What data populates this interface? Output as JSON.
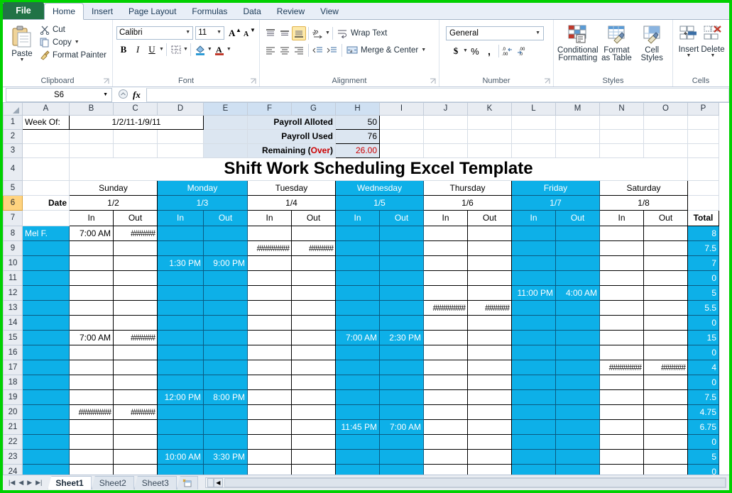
{
  "window": {
    "accent_green": "#00D000",
    "cyan": "#0DB0E8",
    "tint": "#dce6f1"
  },
  "tabs": {
    "file": "File",
    "items": [
      "Home",
      "Insert",
      "Page Layout",
      "Formulas",
      "Data",
      "Review",
      "View"
    ],
    "active": "Home"
  },
  "ribbon": {
    "clipboard": {
      "label": "Clipboard",
      "paste": "Paste",
      "cut": "Cut",
      "copy": "Copy",
      "format_painter": "Format Painter"
    },
    "font": {
      "label": "Font",
      "family": "Calibri",
      "size": "11",
      "bold": "B",
      "italic": "I",
      "underline": "U"
    },
    "alignment": {
      "label": "Alignment",
      "wrap_text": "Wrap Text",
      "merge_center": "Merge & Center"
    },
    "number": {
      "label": "Number",
      "format": "General",
      "currency": "$",
      "percent": "%",
      "comma": ","
    },
    "styles": {
      "label": "Styles",
      "conditional_formatting": "Conditional\nFormatting",
      "conditional_line1": "Conditional",
      "conditional_line2": "Formatting",
      "format_as_table_line1": "Format",
      "format_as_table_line2": "as Table",
      "cell_styles_line1": "Cell",
      "cell_styles_line2": "Styles"
    },
    "cells": {
      "label": "Cells",
      "insert": "Insert",
      "delete": "Delete"
    }
  },
  "formula_bar": {
    "name_box": "S6",
    "formula": ""
  },
  "grid": {
    "columns": [
      "A",
      "B",
      "C",
      "D",
      "E",
      "F",
      "G",
      "H",
      "I",
      "J",
      "K",
      "L",
      "M",
      "N",
      "O",
      "P"
    ],
    "selected_columns": [
      "E",
      "F",
      "G",
      "H"
    ],
    "selected_row": "6",
    "rows": [
      "1",
      "2",
      "3",
      "4",
      "5",
      "6",
      "7",
      "8",
      "9",
      "10",
      "11",
      "12",
      "13",
      "14",
      "15",
      "16",
      "17",
      "18",
      "19",
      "20",
      "21",
      "22",
      "23",
      "24"
    ]
  },
  "sheet": {
    "week_of_label": "Week Of:",
    "week_of_value": "1/2/11-1/9/11",
    "payroll": [
      {
        "label": "Payroll Alloted",
        "value": "50",
        "over": false
      },
      {
        "label": "Payroll Used",
        "value": "76",
        "over": false
      },
      {
        "label": "Remaining (",
        "label_red": "Over",
        "label_end": ")",
        "value": "26.00",
        "over": true
      }
    ],
    "title": "Shift Work Scheduling Excel Template",
    "date_label": "Date",
    "total_label": "Total",
    "in_label": "In",
    "out_label": "Out",
    "days": [
      {
        "name": "Sunday",
        "date": "1/2",
        "highlight": false
      },
      {
        "name": "Monday",
        "date": "1/3",
        "highlight": true
      },
      {
        "name": "Tuesday",
        "date": "1/4",
        "highlight": false
      },
      {
        "name": "Wednesday",
        "date": "1/5",
        "highlight": true
      },
      {
        "name": "Thursday",
        "date": "1/6",
        "highlight": false
      },
      {
        "name": "Friday",
        "date": "1/7",
        "highlight": true
      },
      {
        "name": "Saturday",
        "date": "1/8",
        "highlight": false
      }
    ],
    "hash_short": "######",
    "hash_long": "########",
    "entries": [
      {
        "row": "8",
        "name": "Mel F.",
        "cells": [
          "7:00 AM",
          "######",
          "",
          "",
          "",
          "",
          "",
          "",
          "",
          "",
          "",
          "",
          "",
          ""
        ],
        "total": "8"
      },
      {
        "row": "9",
        "name": "",
        "cells": [
          "",
          "",
          "",
          "",
          "########",
          "######",
          "",
          "",
          "",
          "",
          "",
          "",
          "",
          ""
        ],
        "total": "7.5"
      },
      {
        "row": "10",
        "name": "",
        "cells": [
          "",
          "",
          "1:30 PM",
          "9:00 PM",
          "",
          "",
          "",
          "",
          "",
          "",
          "",
          "",
          "",
          ""
        ],
        "total": "7"
      },
      {
        "row": "11",
        "name": "",
        "cells": [
          "",
          "",
          "",
          "",
          "",
          "",
          "",
          "",
          "",
          "",
          "",
          "",
          "",
          ""
        ],
        "total": "0"
      },
      {
        "row": "12",
        "name": "",
        "cells": [
          "",
          "",
          "",
          "",
          "",
          "",
          "",
          "",
          "",
          "",
          "11:00 PM",
          "4:00 AM",
          "",
          ""
        ],
        "total": "5"
      },
      {
        "row": "13",
        "name": "",
        "cells": [
          "",
          "",
          "",
          "",
          "",
          "",
          "",
          "",
          "########",
          "######",
          "",
          "",
          "",
          ""
        ],
        "total": "5.5"
      },
      {
        "row": "14",
        "name": "",
        "cells": [
          "",
          "",
          "",
          "",
          "",
          "",
          "",
          "",
          "",
          "",
          "",
          "",
          "",
          ""
        ],
        "total": "0"
      },
      {
        "row": "15",
        "name": "",
        "cells": [
          "7:00 AM",
          "######",
          "",
          "",
          "",
          "",
          "7:00 AM",
          "2:30 PM",
          "",
          "",
          "",
          "",
          "",
          ""
        ],
        "total": "15"
      },
      {
        "row": "16",
        "name": "",
        "cells": [
          "",
          "",
          "",
          "",
          "",
          "",
          "",
          "",
          "",
          "",
          "",
          "",
          "",
          ""
        ],
        "total": "0"
      },
      {
        "row": "17",
        "name": "",
        "cells": [
          "",
          "",
          "",
          "",
          "",
          "",
          "",
          "",
          "",
          "",
          "",
          "",
          "########",
          "######"
        ],
        "total": "4"
      },
      {
        "row": "18",
        "name": "",
        "cells": [
          "",
          "",
          "",
          "",
          "",
          "",
          "",
          "",
          "",
          "",
          "",
          "",
          "",
          ""
        ],
        "total": "0"
      },
      {
        "row": "19",
        "name": "",
        "cells": [
          "",
          "",
          "12:00 PM",
          "8:00 PM",
          "",
          "",
          "",
          "",
          "",
          "",
          "",
          "",
          "",
          ""
        ],
        "total": "7.5"
      },
      {
        "row": "20",
        "name": "",
        "cells": [
          "########",
          "######",
          "",
          "",
          "",
          "",
          "",
          "",
          "",
          "",
          "",
          "",
          "",
          ""
        ],
        "total": "4.75"
      },
      {
        "row": "21",
        "name": "",
        "cells": [
          "",
          "",
          "",
          "",
          "",
          "",
          "11:45 PM",
          "7:00 AM",
          "",
          "",
          "",
          "",
          "",
          ""
        ],
        "total": "6.75"
      },
      {
        "row": "22",
        "name": "",
        "cells": [
          "",
          "",
          "",
          "",
          "",
          "",
          "",
          "",
          "",
          "",
          "",
          "",
          "",
          ""
        ],
        "total": "0"
      },
      {
        "row": "23",
        "name": "",
        "cells": [
          "",
          "",
          "10:00 AM",
          "3:30 PM",
          "",
          "",
          "",
          "",
          "",
          "",
          "",
          "",
          "",
          ""
        ],
        "total": "5"
      },
      {
        "row": "24",
        "name": "",
        "cells": [
          "",
          "",
          "",
          "",
          "",
          "",
          "",
          "",
          "",
          "",
          "",
          "",
          "",
          ""
        ],
        "total": "0"
      }
    ]
  },
  "sheet_tabs": {
    "items": [
      "Sheet1",
      "Sheet2",
      "Sheet3"
    ],
    "active": "Sheet1",
    "new_sheet_icon": "new-sheet-icon"
  }
}
